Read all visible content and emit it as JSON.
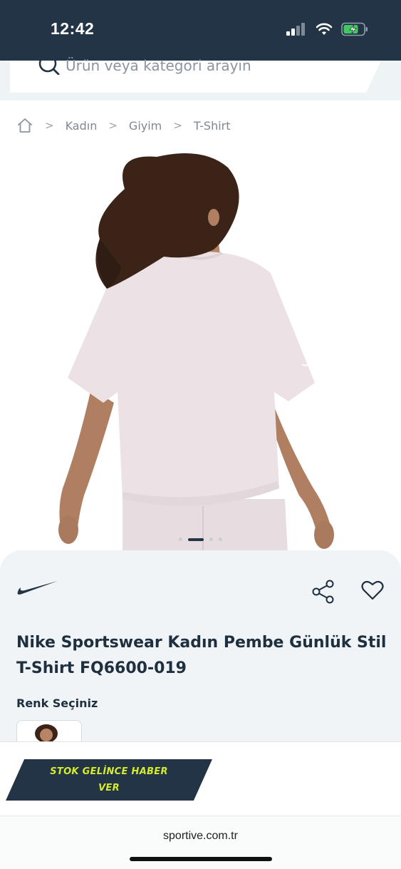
{
  "status_bar": {
    "time": "12:42"
  },
  "search": {
    "placeholder": "Ürün veya kategori arayın"
  },
  "breadcrumb": {
    "items": [
      "Kadın",
      "Giyim",
      "T-Shirt"
    ]
  },
  "gallery": {
    "slide_count": 4,
    "active_index": 1
  },
  "product": {
    "brand_icon": "nike-swoosh-logo",
    "title": "Nike Sportswear Kadın Pembe Günlük Stil T-Shirt FQ6600-019",
    "color_label": "Renk Seçiniz"
  },
  "cta": {
    "notify_label": "STOK GELİNCE HABER VER"
  },
  "browser": {
    "url": "sportive.com.tr"
  },
  "colors": {
    "navy": "#223445",
    "accent": "#d4ec2a",
    "panel": "#f1f4f6"
  }
}
